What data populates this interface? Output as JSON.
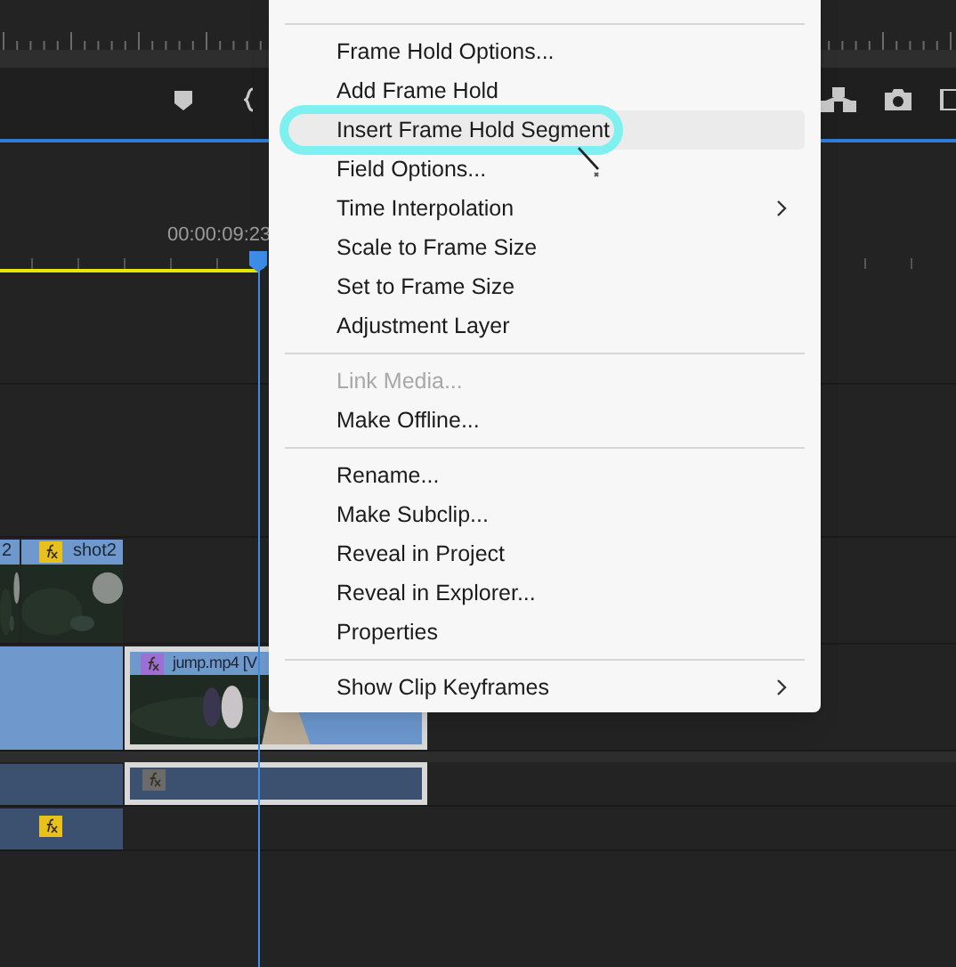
{
  "timeline": {
    "timecode": "00:00:09:23",
    "video_tracks": [
      {
        "clips": [
          {
            "label": "2"
          },
          {
            "label": "shot2",
            "fx": {
              "color": "#e8c21a"
            }
          }
        ]
      },
      {
        "clips": [
          {
            "label": "jump.mp4 [V",
            "fx": {
              "color": "#9b6fd6"
            }
          }
        ]
      }
    ],
    "audio_tracks": [
      {
        "clips": [
          {
            "fx": {
              "color": "#6b6b6b"
            }
          }
        ]
      },
      {
        "clips": [
          {
            "fx": {
              "color": "#e8c21a"
            }
          }
        ]
      }
    ]
  },
  "context_menu": {
    "items": [
      {
        "kind": "separator"
      },
      {
        "kind": "item",
        "label": "Frame Hold Options...",
        "disabled": false,
        "submenu": false,
        "selected": false
      },
      {
        "kind": "item",
        "label": "Add Frame Hold",
        "disabled": false,
        "submenu": false,
        "selected": false
      },
      {
        "kind": "item",
        "label": "Insert Frame Hold Segment",
        "disabled": false,
        "submenu": false,
        "selected": true
      },
      {
        "kind": "item",
        "label": "Field Options...",
        "disabled": false,
        "submenu": false,
        "selected": false
      },
      {
        "kind": "item",
        "label": "Time Interpolation",
        "disabled": false,
        "submenu": true,
        "selected": false
      },
      {
        "kind": "item",
        "label": "Scale to Frame Size",
        "disabled": false,
        "submenu": false,
        "selected": false
      },
      {
        "kind": "item",
        "label": "Set to Frame Size",
        "disabled": false,
        "submenu": false,
        "selected": false
      },
      {
        "kind": "item",
        "label": "Adjustment Layer",
        "disabled": false,
        "submenu": false,
        "selected": false
      },
      {
        "kind": "separator"
      },
      {
        "kind": "item",
        "label": "Link Media...",
        "disabled": true,
        "submenu": false,
        "selected": false
      },
      {
        "kind": "item",
        "label": "Make Offline...",
        "disabled": false,
        "submenu": false,
        "selected": false
      },
      {
        "kind": "separator"
      },
      {
        "kind": "item",
        "label": "Rename...",
        "disabled": false,
        "submenu": false,
        "selected": false
      },
      {
        "kind": "item",
        "label": "Make Subclip...",
        "disabled": false,
        "submenu": false,
        "selected": false
      },
      {
        "kind": "item",
        "label": "Reveal in Project",
        "disabled": false,
        "submenu": false,
        "selected": false
      },
      {
        "kind": "item",
        "label": "Reveal in Explorer...",
        "disabled": false,
        "submenu": false,
        "selected": false
      },
      {
        "kind": "item",
        "label": "Properties",
        "disabled": false,
        "submenu": false,
        "selected": false
      },
      {
        "kind": "separator"
      },
      {
        "kind": "item",
        "label": "Show Clip Keyframes",
        "disabled": false,
        "submenu": true,
        "selected": false
      }
    ]
  }
}
